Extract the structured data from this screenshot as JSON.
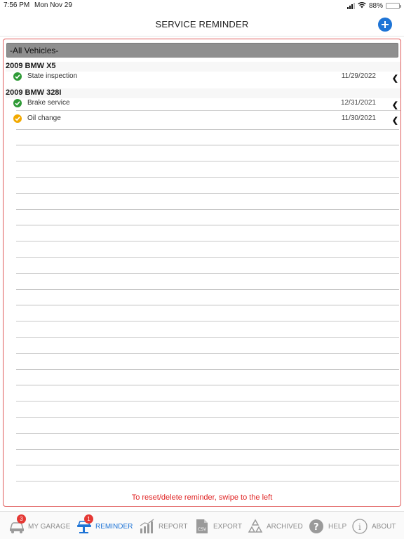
{
  "status_bar": {
    "time": "7:56 PM",
    "date": "Mon Nov 29",
    "battery_percent": "88%",
    "battery_level": 0.88,
    "icons": [
      "cellular-signal-icon",
      "wifi-icon",
      "battery-icon"
    ]
  },
  "nav": {
    "title": "SERVICE REMINDER",
    "add_icon": "plus-circle-icon",
    "accent_color": "#1e74d6"
  },
  "filter": {
    "selected": "-All Vehicles-"
  },
  "groups": [
    {
      "vehicle": "2009 BMW X5",
      "reminders": [
        {
          "label": "State inspection",
          "date": "11/29/2022",
          "status": "ok",
          "status_icon": "check-circle-icon",
          "chevron": "chevron-left-icon"
        }
      ]
    },
    {
      "vehicle": "2009 BMW 328I",
      "reminders": [
        {
          "label": "Brake service",
          "date": "12/31/2021",
          "status": "ok",
          "status_icon": "check-circle-icon",
          "chevron": "chevron-left-icon"
        },
        {
          "label": "Oil change",
          "date": "11/30/2021",
          "status": "warning",
          "status_icon": "check-circle-icon",
          "chevron": "chevron-left-icon"
        }
      ]
    }
  ],
  "hint": "To reset/delete reminder, swipe to the left",
  "colors": {
    "ok": "#2e9a36",
    "warning": "#f2a900",
    "hint": "#e02424",
    "panel_border": "#e05c5c"
  },
  "tabs": [
    {
      "label": "MY GARAGE",
      "icon": "car-icon",
      "badge": "3",
      "active": false
    },
    {
      "label": "REMINDER",
      "icon": "car-lift-icon",
      "badge": "1",
      "active": true
    },
    {
      "label": "REPORT",
      "icon": "bar-chart-icon",
      "badge": null,
      "active": false
    },
    {
      "label": "EXPORT",
      "icon": "csv-file-icon",
      "badge": null,
      "active": false
    },
    {
      "label": "ARCHIVED",
      "icon": "recycle-icon",
      "badge": null,
      "active": false
    },
    {
      "label": "HELP",
      "icon": "question-circle-icon",
      "badge": null,
      "active": false
    },
    {
      "label": "ABOUT",
      "icon": "info-circle-icon",
      "badge": null,
      "active": false
    }
  ]
}
